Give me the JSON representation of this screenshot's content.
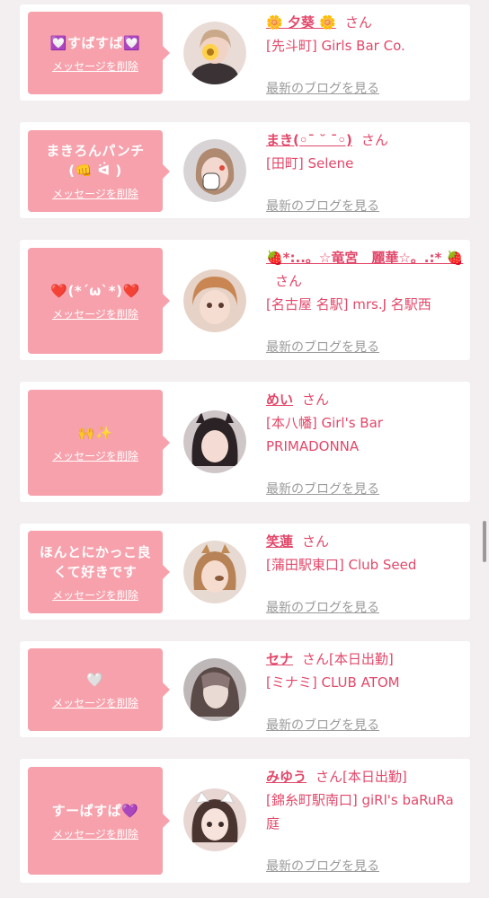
{
  "delete_label": "メッセージを削除",
  "san_label": "さん",
  "blog_label": "最新のブログを見る",
  "accent_color": "#e2486a",
  "bubble_color": "#f7a1ac",
  "items": [
    {
      "message": "💟すばすば💟",
      "name": "🌼 夕葵 🌼",
      "status": "",
      "shop": "[先斗町] Girls Bar Co.",
      "avatar_icon": "avatar-photo-icon"
    },
    {
      "message": "まきろんパンチ(👊 ᐛ )",
      "name": "まき(◦ˉ ˘ ˉ◦)",
      "status": "",
      "shop": "[田町] Selene",
      "avatar_icon": "avatar-photo-icon"
    },
    {
      "message": "❤️(*´ω`*)❤️",
      "name": "🍓*:..。☆竜宮　麗華☆。.:* 🍓",
      "status": "",
      "shop": "[名古屋 名駅] mrs.J 名駅西",
      "avatar_icon": "avatar-photo-icon"
    },
    {
      "message": "🙌✨",
      "name": "めい",
      "status": "",
      "shop": "[本八幡] Girl's Bar PRIMADONNA",
      "avatar_icon": "avatar-photo-icon"
    },
    {
      "message": "ほんとにかっこ良くて好きです",
      "name": "笑蓮",
      "status": "",
      "shop": "[蒲田駅東口] Club Seed",
      "avatar_icon": "avatar-photo-icon"
    },
    {
      "message": "🤍",
      "name": "セナ",
      "status": "[本日出勤]",
      "shop": "[ミナミ] CLUB ATOM",
      "avatar_icon": "avatar-photo-icon"
    },
    {
      "message": "すーぱすぱ💜",
      "name": "みゆう",
      "status": "[本日出勤]",
      "shop": "[錦糸町駅南口] giRl's baRuRa庭",
      "avatar_icon": "avatar-photo-icon"
    }
  ]
}
